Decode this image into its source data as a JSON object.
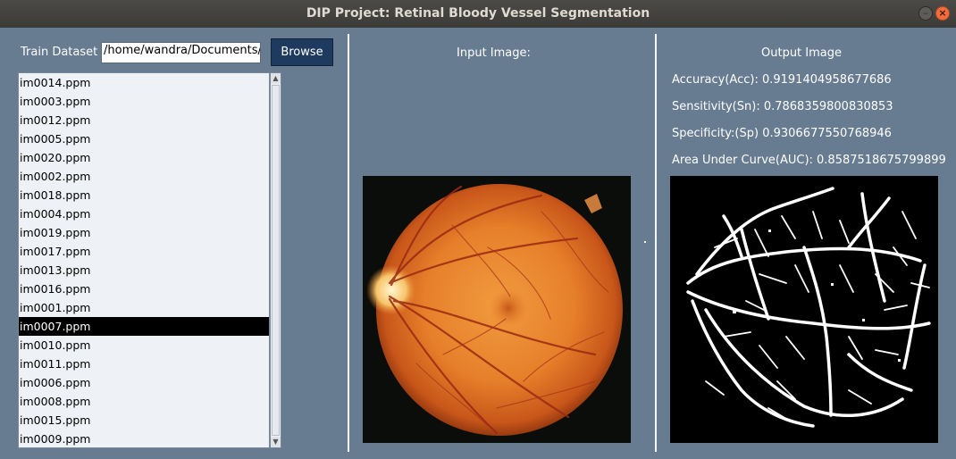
{
  "window": {
    "title": "DIP Project: Retinal Bloody Vessel Segmentation",
    "minimize_label": "–",
    "close_label": "×"
  },
  "left_panel": {
    "train_label": "Train Dataset",
    "path_value": "/home/wandra/Documents/SE",
    "browse_label": "Browse",
    "files": [
      "im0014.ppm",
      "im0003.ppm",
      "im0012.ppm",
      "im0005.ppm",
      "im0020.ppm",
      "im0002.ppm",
      "im0018.ppm",
      "im0004.ppm",
      "im0019.ppm",
      "im0017.ppm",
      "im0013.ppm",
      "im0016.ppm",
      "im0001.ppm",
      "im0007.ppm",
      "im0010.ppm",
      "im0011.ppm",
      "im0006.ppm",
      "im0008.ppm",
      "im0015.ppm",
      "im0009.ppm"
    ],
    "selected_file": "im0007.ppm"
  },
  "middle_panel": {
    "input_label": "Input Image:"
  },
  "right_panel": {
    "output_label": "Output Image",
    "accuracy": "Accuracy(Acc): 0.9191404958677686",
    "sensitivity": "Sensitivity(Sn): 0.7868359800830853",
    "specificity": "Specificity:(Sp) 0.9306677550768946",
    "auc": "Area Under Curve(AUC): 0.8587518675799899"
  },
  "colors": {
    "background": "#677b91",
    "titlebar": "#3c3b37",
    "browse_button": "#1f3a5f",
    "selection": "#000000",
    "retina": "#e8822a",
    "close_button": "#f06d3f"
  }
}
